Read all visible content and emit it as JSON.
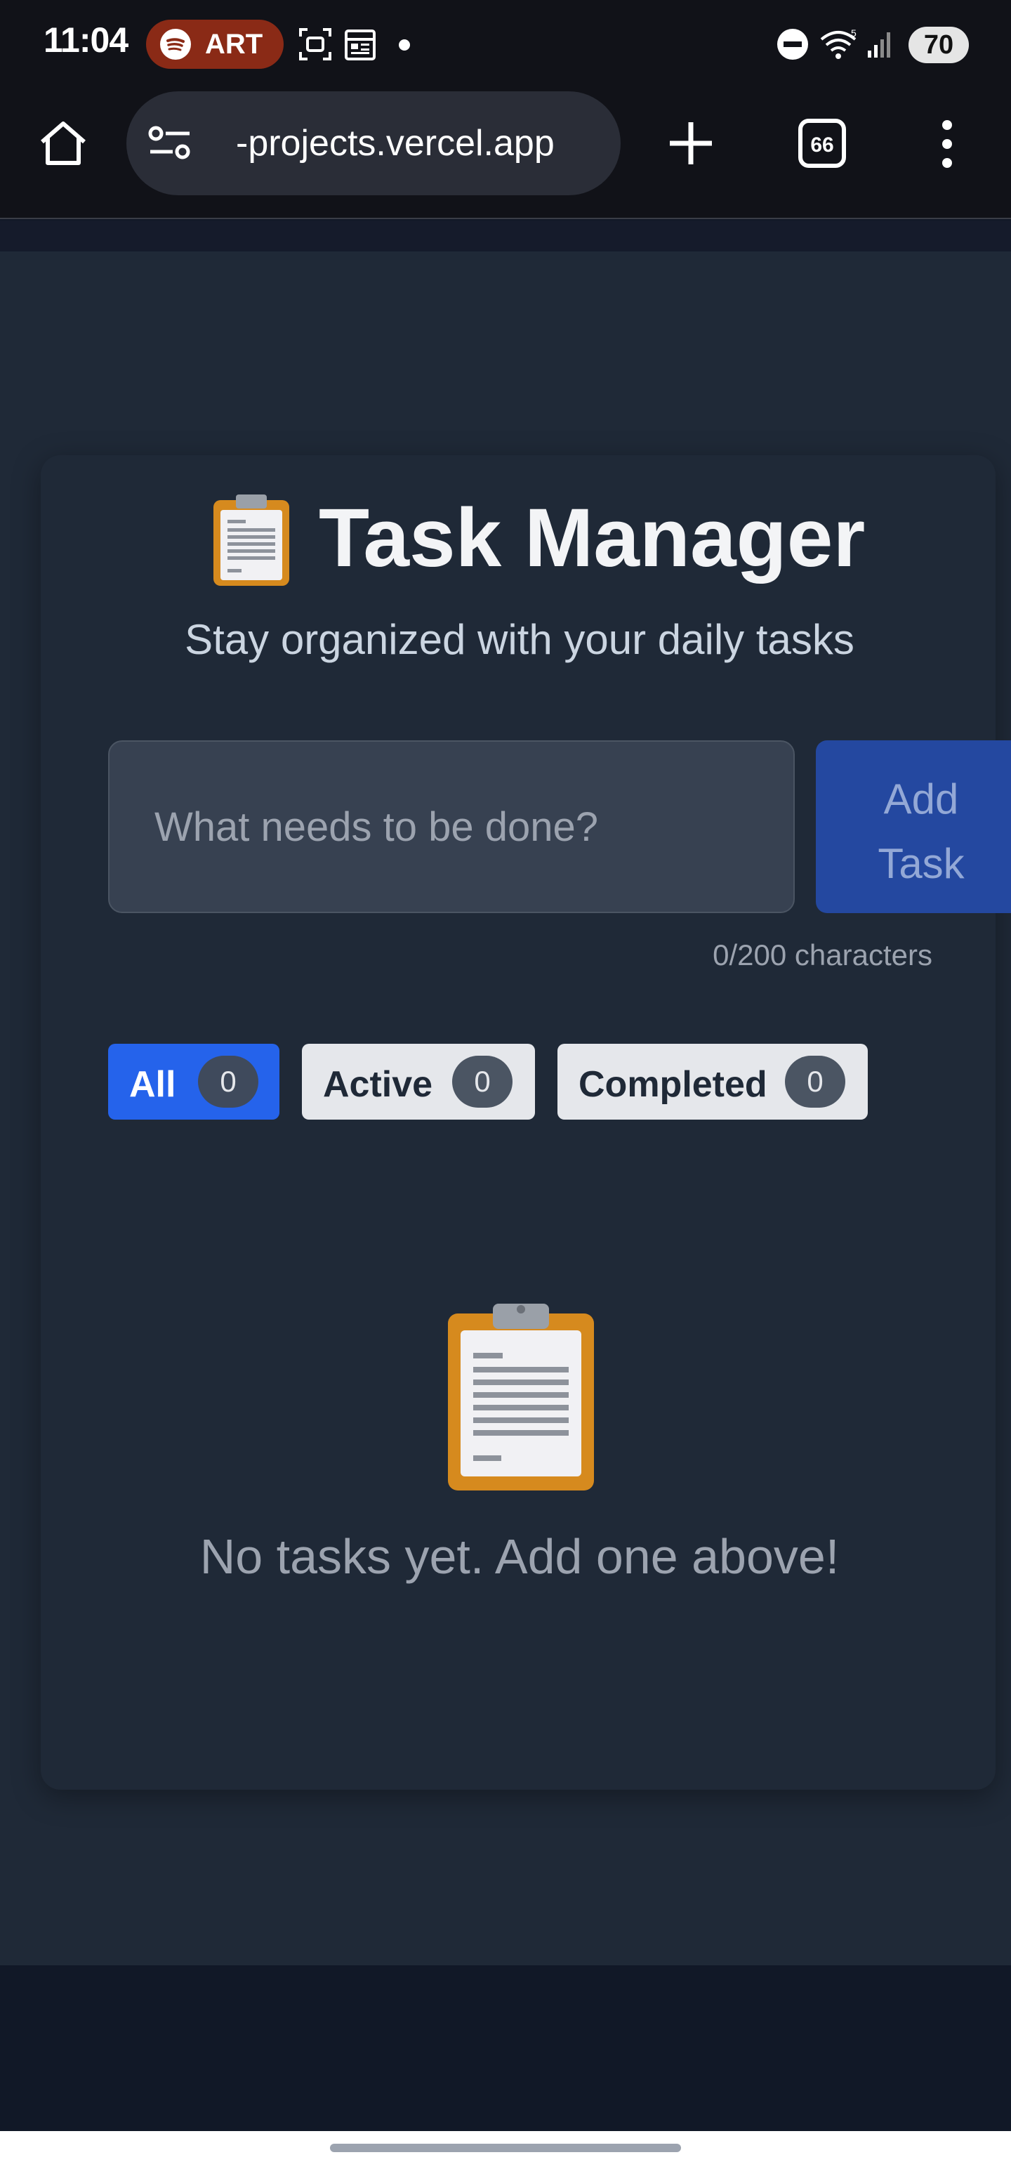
{
  "status_bar": {
    "time": "11:04",
    "spotify_label": "ART",
    "battery": "70",
    "icons": [
      "spotify-icon",
      "screenshot-icon",
      "calendar-icon",
      "dnd-icon",
      "wifi-icon",
      "signal-icon"
    ]
  },
  "browser": {
    "url": "-projects.vercel.app",
    "tab_count": "66",
    "icons": [
      "home-icon",
      "site-settings-icon",
      "new-tab-icon",
      "tabs-icon",
      "menu-icon"
    ]
  },
  "app": {
    "title": "Task Manager",
    "subtitle": "Stay organized with your daily tasks",
    "input_placeholder": "What needs to be done?",
    "add_button": "Add Task",
    "char_count": "0/200 characters",
    "filters": [
      {
        "label": "All",
        "count": "0",
        "selected": true
      },
      {
        "label": "Active",
        "count": "0",
        "selected": false
      },
      {
        "label": "Completed",
        "count": "0",
        "selected": false
      }
    ],
    "empty_message": "No tasks yet. Add one above!"
  },
  "colors": {
    "page_bg": "#1f2937",
    "accent": "#2563eb",
    "button_bg": "#2448a0",
    "filter_idle": "#e5e7eb"
  }
}
